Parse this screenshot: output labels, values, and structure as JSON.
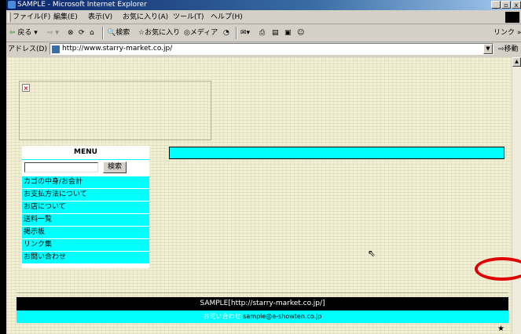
{
  "window": {
    "title": "SAMPLE - Microsoft Internet Explorer",
    "min": "_",
    "max": "▫",
    "close": "x"
  },
  "menubar": [
    "ファイル(F)",
    "編集(E)",
    "表示(V)",
    "お気に入り(A)",
    "ツール(T)",
    "ヘルプ(H)"
  ],
  "toolbar": {
    "back": "戻る",
    "search": "検索",
    "favorites": "お気に入り",
    "media": "メディア",
    "links": "リンク"
  },
  "addressbar": {
    "label": "アドレス(D)",
    "url": "http://www.starry-market.co.jp/",
    "go": "移動"
  },
  "sidebar": {
    "menu_title": "MENU",
    "search_button": "検索",
    "items": [
      "カゴの中身/お会計",
      "お支払方法について",
      "お店について",
      "送料一覧",
      "掲示板",
      "リンク集",
      "お問い合わせ"
    ]
  },
  "footer": {
    "site": "SAMPLE[http://starry-market.co.jp/]",
    "contact_label": "お問い合わせ:",
    "email": "sample@e-showten.co.jp"
  },
  "mark": "★",
  "colors": {
    "accent": "#00ffff",
    "footer_bg": "#000000",
    "annotation": "#e00000",
    "page_bg": "#f1efd4"
  }
}
